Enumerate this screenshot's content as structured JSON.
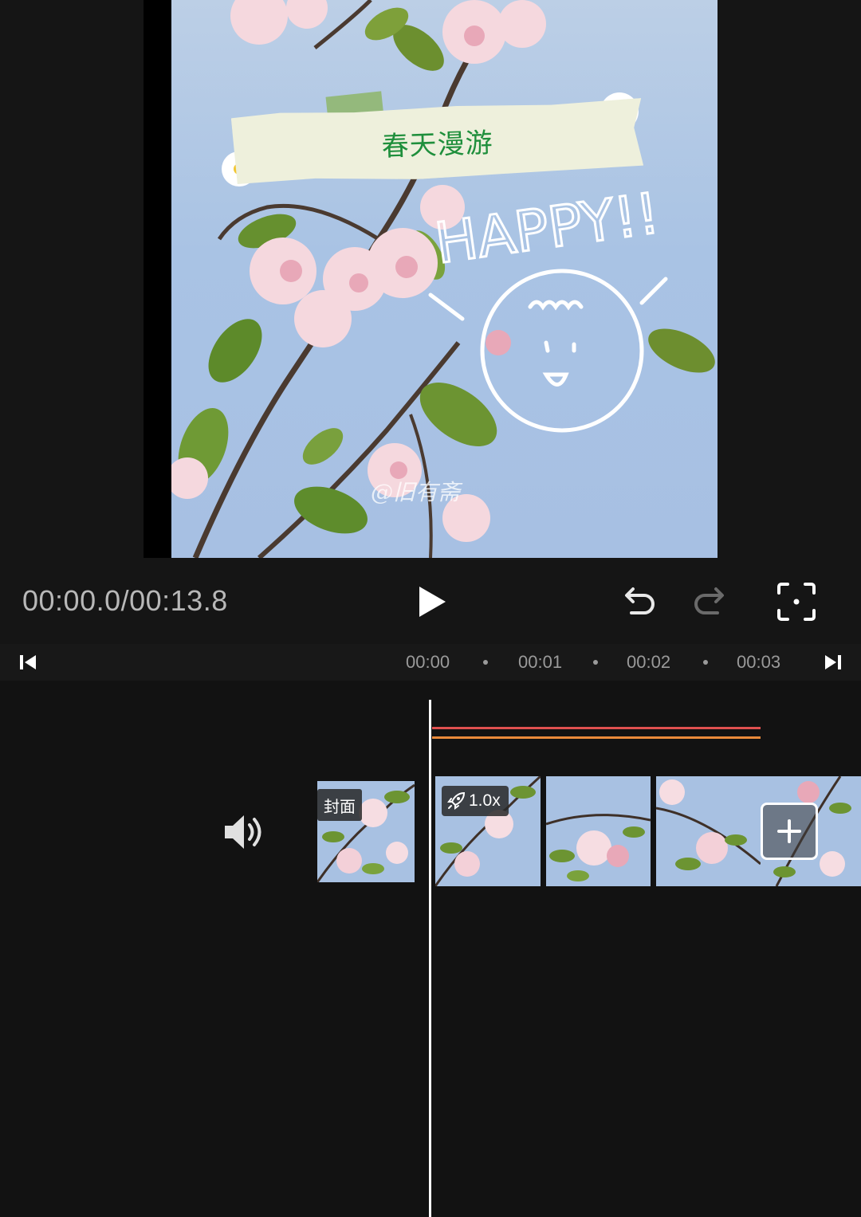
{
  "preview": {
    "title_text": "春天漫游",
    "sticker_text": "HAPPY!!",
    "watermark": "@旧有斋"
  },
  "player": {
    "time_display": "00:00.0/00:13.8",
    "play_icon": "play-icon",
    "undo_icon": "undo-icon",
    "redo_icon": "redo-icon",
    "fullscreen_icon": "fullscreen-icon"
  },
  "ruler": {
    "ticks": [
      "00:00",
      "00:01",
      "00:02",
      "00:03"
    ],
    "skip_start_icon": "skip-to-start-icon",
    "skip_end_icon": "skip-to-end-icon"
  },
  "timeline": {
    "audio_icon": "speaker-icon",
    "cover_label": "封面",
    "speed_label": "1.0x",
    "speed_icon": "rocket-icon",
    "add_clip_icon": "plus-icon",
    "track_colors": [
      "#e0504f",
      "#e98a3a"
    ]
  }
}
